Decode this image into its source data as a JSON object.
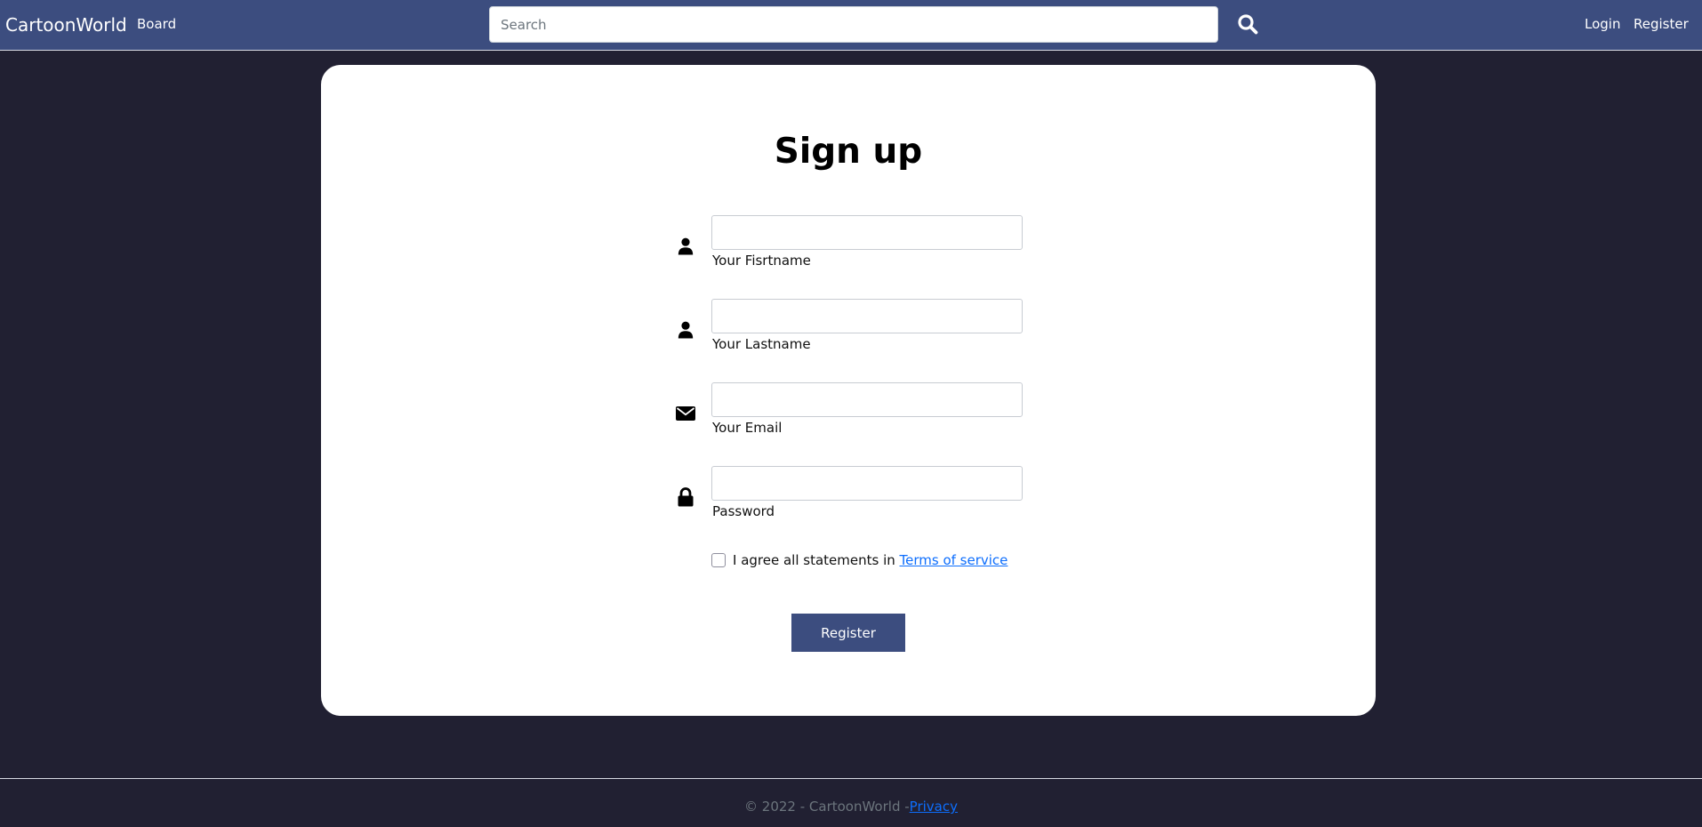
{
  "navbar": {
    "brand": "CartoonWorld",
    "links": {
      "board": "Board",
      "login": "Login",
      "register": "Register"
    },
    "search": {
      "placeholder": "Search",
      "value": "",
      "icon": "search-icon"
    },
    "background": "#3c4d7f"
  },
  "form": {
    "title": "Sign up",
    "fields": [
      {
        "icon": "user-icon",
        "label": "Your Fisrtname",
        "value": ""
      },
      {
        "icon": "user-icon",
        "label": "Your Lastname",
        "value": ""
      },
      {
        "icon": "envelope-icon",
        "label": "Your Email",
        "value": ""
      },
      {
        "icon": "lock-icon",
        "label": "Password",
        "value": ""
      }
    ],
    "agree": {
      "text": "I agree all statements in ",
      "link": "Terms of service",
      "checked": false
    },
    "submit_label": "Register"
  },
  "footer": {
    "text": "© 2022 - CartoonWorld -",
    "privacy": "Privacy"
  },
  "colors": {
    "page_bg": "#212032",
    "accent": "#3c4d7f",
    "link": "#0d6efd"
  }
}
